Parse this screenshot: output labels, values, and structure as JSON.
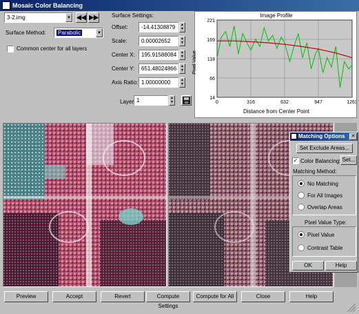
{
  "window": {
    "title": "Mosaic Color Balancing"
  },
  "image_select": {
    "value": "3-2.img"
  },
  "surface_method": {
    "label": "Surface Method:",
    "value": "Parabolic"
  },
  "common_center": {
    "label": "Common center for all layers",
    "checked": false
  },
  "surface_settings": {
    "title": "Surface Settings:",
    "offset_label": "Offset:",
    "offset": "-14.41308879",
    "scale_label": "Scale:",
    "scale": "0.00002652",
    "center_x_label": "Center X:",
    "center_x": "195.91588084",
    "center_y_label": "Center Y:",
    "center_y": "651.48024866",
    "axis_ratio_label": "Axis Ratio:",
    "axis_ratio": "1.00000000",
    "layer_label": "Layer:",
    "layer": "1"
  },
  "profile": {
    "title": "Image Profile",
    "ylabel": "Pixel Value",
    "xlabel": "Distance from Center Point",
    "yticks": [
      "221",
      "169",
      "118",
      "66",
      "14"
    ],
    "xticks": [
      "0",
      "316",
      "632",
      "947",
      "1263"
    ]
  },
  "chart_data": {
    "type": "line",
    "title": "Image Profile",
    "xlabel": "Distance from Center Point",
    "ylabel": "Pixel Value",
    "xlim": [
      0,
      1263
    ],
    "ylim": [
      14,
      221
    ],
    "series": [
      {
        "x": [
          0,
          40,
          80,
          120,
          160,
          200,
          240,
          280,
          316,
          360,
          400,
          440,
          480,
          520,
          560,
          600,
          632,
          680,
          720,
          760,
          800,
          840,
          880,
          920,
          947,
          990,
          1030,
          1070,
          1110,
          1150,
          1190,
          1230,
          1263
        ],
        "y": [
          120,
          175,
          190,
          150,
          205,
          130,
          185,
          160,
          140,
          170,
          150,
          200,
          165,
          180,
          145,
          175,
          160,
          110,
          150,
          185,
          120,
          160,
          90,
          130,
          145,
          80,
          120,
          95,
          150,
          40,
          110,
          90,
          100
        ]
      },
      {
        "x": [
          0,
          158,
          316,
          474,
          632,
          790,
          947,
          1105,
          1263
        ],
        "y": [
          165,
          165,
          163,
          160,
          156,
          150,
          143,
          133,
          120
        ]
      }
    ],
    "colors": [
      "#00c000",
      "#c00000"
    ]
  },
  "matching_options": {
    "title": "Matching Options",
    "set_exclude": "Set Exclude Areas...",
    "color_balancing": "Color Balancing:",
    "color_balancing_checked": true,
    "set": "Set...",
    "method_label": "Matching Method:",
    "methods": [
      "No Matching",
      "For All Images",
      "Overlap Areas"
    ],
    "method_selected": 0,
    "pixel_type_label": "Pixel Value Type:",
    "pixel_types": [
      "Pixel Value",
      "Contrast Table"
    ],
    "pixel_type_selected": 0,
    "ok": "OK",
    "help": "Help"
  },
  "buttons": {
    "preview": "Preview",
    "accept": "Accept",
    "revert": "Revert",
    "compute_settings": "Compute Settings",
    "compute_all": "Compute for All",
    "close": "Close",
    "help": "Help"
  }
}
